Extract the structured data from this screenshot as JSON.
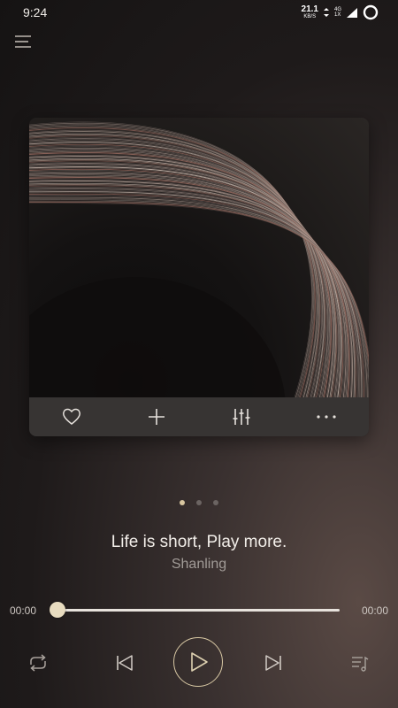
{
  "status_bar": {
    "time": "9:24",
    "net_speed_value": "21.1",
    "net_speed_unit": "KB/S",
    "network_top": "4G",
    "network_bottom": "1X"
  },
  "pager": {
    "count": 3,
    "active_index": 0
  },
  "track": {
    "title": "Life is short, Play more.",
    "artist": "Shanling"
  },
  "progress": {
    "current_time": "00:00",
    "total_time": "00:00",
    "fraction": 0
  },
  "colors": {
    "accent": "#d8c6a0",
    "background": "#1e1a1a",
    "text": "#f2eee9",
    "secondary_text": "#a19b97"
  },
  "icons": {
    "menu": "menu-icon",
    "favorite": "heart-icon",
    "add": "plus-icon",
    "equalizer": "equalizer-icon",
    "more": "more-icon",
    "repeat": "repeat-icon",
    "previous": "previous-icon",
    "play": "play-icon",
    "next": "next-icon",
    "playlist": "playlist-icon"
  }
}
